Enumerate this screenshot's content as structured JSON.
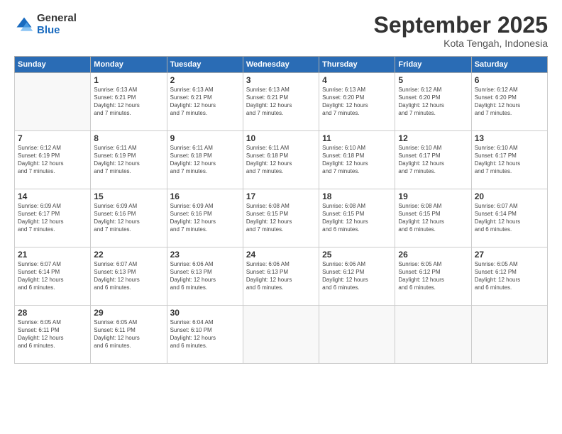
{
  "logo": {
    "general": "General",
    "blue": "Blue"
  },
  "title": "September 2025",
  "subtitle": "Kota Tengah, Indonesia",
  "days_header": [
    "Sunday",
    "Monday",
    "Tuesday",
    "Wednesday",
    "Thursday",
    "Friday",
    "Saturday"
  ],
  "weeks": [
    [
      {
        "num": "",
        "info": ""
      },
      {
        "num": "1",
        "info": "Sunrise: 6:13 AM\nSunset: 6:21 PM\nDaylight: 12 hours\nand 7 minutes."
      },
      {
        "num": "2",
        "info": "Sunrise: 6:13 AM\nSunset: 6:21 PM\nDaylight: 12 hours\nand 7 minutes."
      },
      {
        "num": "3",
        "info": "Sunrise: 6:13 AM\nSunset: 6:21 PM\nDaylight: 12 hours\nand 7 minutes."
      },
      {
        "num": "4",
        "info": "Sunrise: 6:13 AM\nSunset: 6:20 PM\nDaylight: 12 hours\nand 7 minutes."
      },
      {
        "num": "5",
        "info": "Sunrise: 6:12 AM\nSunset: 6:20 PM\nDaylight: 12 hours\nand 7 minutes."
      },
      {
        "num": "6",
        "info": "Sunrise: 6:12 AM\nSunset: 6:20 PM\nDaylight: 12 hours\nand 7 minutes."
      }
    ],
    [
      {
        "num": "7",
        "info": "Sunrise: 6:12 AM\nSunset: 6:19 PM\nDaylight: 12 hours\nand 7 minutes."
      },
      {
        "num": "8",
        "info": "Sunrise: 6:11 AM\nSunset: 6:19 PM\nDaylight: 12 hours\nand 7 minutes."
      },
      {
        "num": "9",
        "info": "Sunrise: 6:11 AM\nSunset: 6:18 PM\nDaylight: 12 hours\nand 7 minutes."
      },
      {
        "num": "10",
        "info": "Sunrise: 6:11 AM\nSunset: 6:18 PM\nDaylight: 12 hours\nand 7 minutes."
      },
      {
        "num": "11",
        "info": "Sunrise: 6:10 AM\nSunset: 6:18 PM\nDaylight: 12 hours\nand 7 minutes."
      },
      {
        "num": "12",
        "info": "Sunrise: 6:10 AM\nSunset: 6:17 PM\nDaylight: 12 hours\nand 7 minutes."
      },
      {
        "num": "13",
        "info": "Sunrise: 6:10 AM\nSunset: 6:17 PM\nDaylight: 12 hours\nand 7 minutes."
      }
    ],
    [
      {
        "num": "14",
        "info": "Sunrise: 6:09 AM\nSunset: 6:17 PM\nDaylight: 12 hours\nand 7 minutes."
      },
      {
        "num": "15",
        "info": "Sunrise: 6:09 AM\nSunset: 6:16 PM\nDaylight: 12 hours\nand 7 minutes."
      },
      {
        "num": "16",
        "info": "Sunrise: 6:09 AM\nSunset: 6:16 PM\nDaylight: 12 hours\nand 7 minutes."
      },
      {
        "num": "17",
        "info": "Sunrise: 6:08 AM\nSunset: 6:15 PM\nDaylight: 12 hours\nand 7 minutes."
      },
      {
        "num": "18",
        "info": "Sunrise: 6:08 AM\nSunset: 6:15 PM\nDaylight: 12 hours\nand 6 minutes."
      },
      {
        "num": "19",
        "info": "Sunrise: 6:08 AM\nSunset: 6:15 PM\nDaylight: 12 hours\nand 6 minutes."
      },
      {
        "num": "20",
        "info": "Sunrise: 6:07 AM\nSunset: 6:14 PM\nDaylight: 12 hours\nand 6 minutes."
      }
    ],
    [
      {
        "num": "21",
        "info": "Sunrise: 6:07 AM\nSunset: 6:14 PM\nDaylight: 12 hours\nand 6 minutes."
      },
      {
        "num": "22",
        "info": "Sunrise: 6:07 AM\nSunset: 6:13 PM\nDaylight: 12 hours\nand 6 minutes."
      },
      {
        "num": "23",
        "info": "Sunrise: 6:06 AM\nSunset: 6:13 PM\nDaylight: 12 hours\nand 6 minutes."
      },
      {
        "num": "24",
        "info": "Sunrise: 6:06 AM\nSunset: 6:13 PM\nDaylight: 12 hours\nand 6 minutes."
      },
      {
        "num": "25",
        "info": "Sunrise: 6:06 AM\nSunset: 6:12 PM\nDaylight: 12 hours\nand 6 minutes."
      },
      {
        "num": "26",
        "info": "Sunrise: 6:05 AM\nSunset: 6:12 PM\nDaylight: 12 hours\nand 6 minutes."
      },
      {
        "num": "27",
        "info": "Sunrise: 6:05 AM\nSunset: 6:12 PM\nDaylight: 12 hours\nand 6 minutes."
      }
    ],
    [
      {
        "num": "28",
        "info": "Sunrise: 6:05 AM\nSunset: 6:11 PM\nDaylight: 12 hours\nand 6 minutes."
      },
      {
        "num": "29",
        "info": "Sunrise: 6:05 AM\nSunset: 6:11 PM\nDaylight: 12 hours\nand 6 minutes."
      },
      {
        "num": "30",
        "info": "Sunrise: 6:04 AM\nSunset: 6:10 PM\nDaylight: 12 hours\nand 6 minutes."
      },
      {
        "num": "",
        "info": ""
      },
      {
        "num": "",
        "info": ""
      },
      {
        "num": "",
        "info": ""
      },
      {
        "num": "",
        "info": ""
      }
    ]
  ]
}
